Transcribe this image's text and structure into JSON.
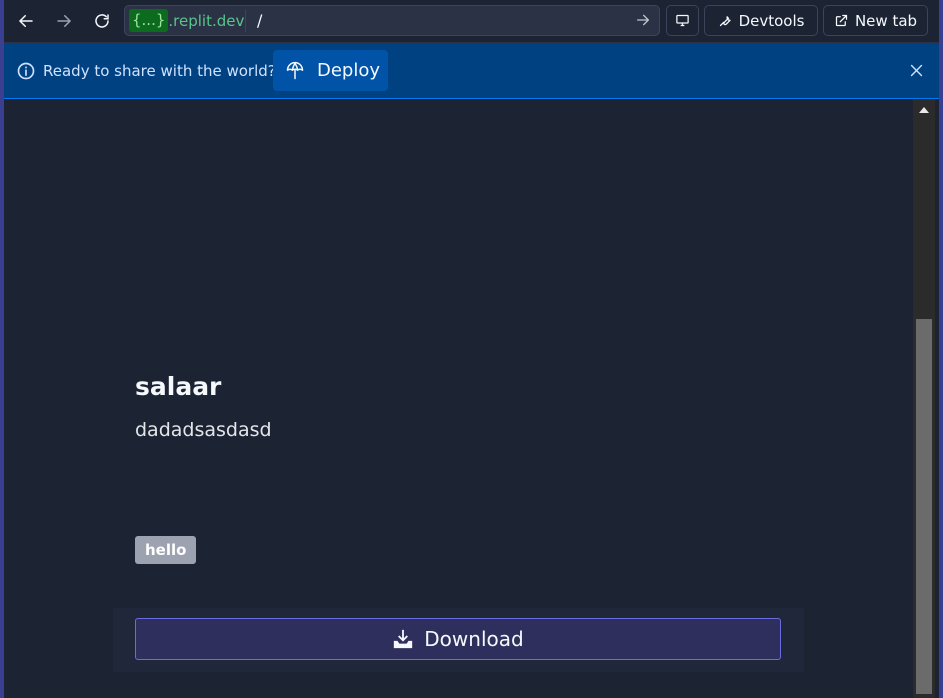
{
  "browser": {
    "host_brace": "{...}",
    "host_domain": ".replit.dev",
    "path": "/",
    "devtools_label": "Devtools",
    "new_tab_label": "New tab"
  },
  "banner": {
    "message": "Ready to share with the world?",
    "deploy_label": "Deploy"
  },
  "card": {
    "title": "salaar",
    "description": "dadadsasdasd",
    "tag": "hello",
    "download_label": "Download"
  },
  "colors": {
    "background": "#1c2333",
    "banner": "#004182",
    "deploy_button": "#0053a6",
    "download_button": "#2f2f5d",
    "download_border": "#6b6be0",
    "tag": "#9da2b0",
    "host_green": "#58c58a"
  },
  "icons": [
    "back-arrow-icon",
    "forward-arrow-icon",
    "reload-icon",
    "go-arrow-icon",
    "monitor-icon",
    "wrench-icon",
    "external-link-icon",
    "info-icon",
    "deploy-icon",
    "close-icon",
    "download-icon"
  ]
}
